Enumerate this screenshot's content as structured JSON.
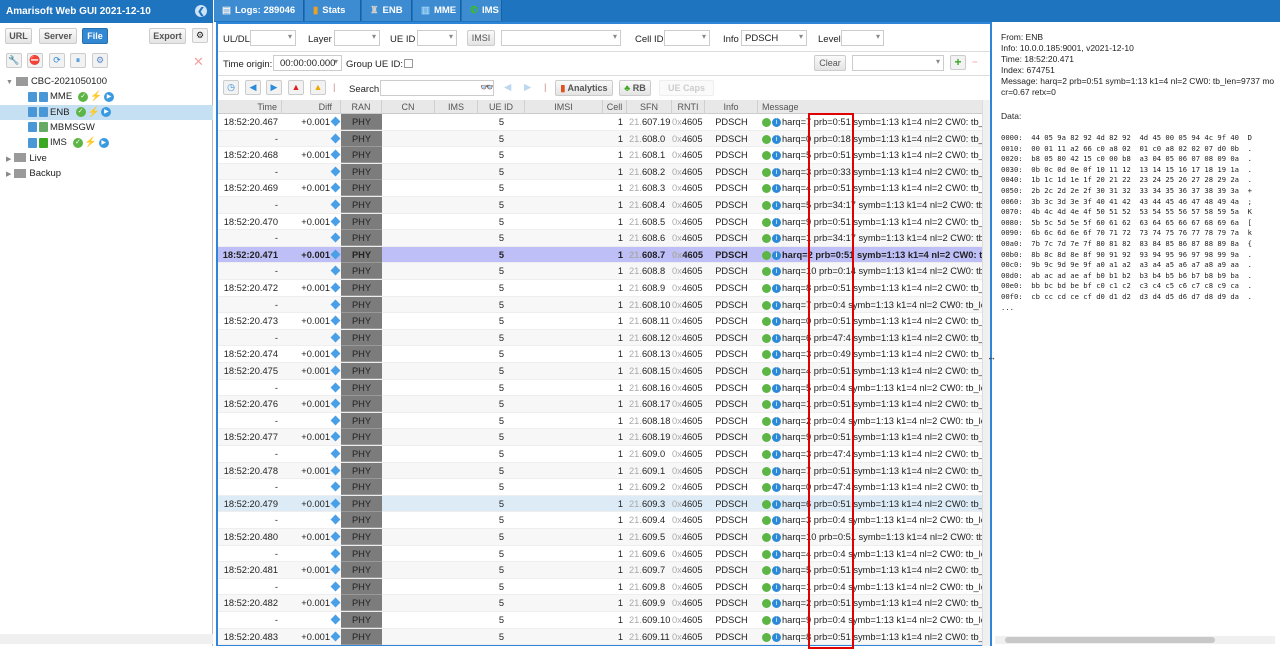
{
  "app": {
    "title": "Amarisoft Web GUI 2021-12-10"
  },
  "left": {
    "buttons": {
      "url": "URL",
      "server": "Server",
      "file": "File",
      "export": "Export"
    },
    "tree": [
      {
        "label": "CBC-2021050100",
        "type": "folder"
      },
      {
        "label": "MME",
        "status": true
      },
      {
        "label": "ENB",
        "status": true,
        "selected": true
      },
      {
        "label": "MBMSGW",
        "status": false
      },
      {
        "label": "IMS",
        "status": true
      },
      {
        "label": "Live",
        "type": "folder"
      },
      {
        "label": "Backup",
        "type": "folder"
      }
    ]
  },
  "tabs": [
    {
      "label": "Logs: 289046",
      "icon": "document-icon"
    },
    {
      "label": "Stats",
      "icon": "bar-chart-icon"
    },
    {
      "label": "ENB",
      "icon": "antenna-icon"
    },
    {
      "label": "MME",
      "icon": "server-icon"
    },
    {
      "label": "IMS",
      "icon": "phone-icon"
    }
  ],
  "filters": {
    "uldl": "UL/DL",
    "layer": "Layer",
    "ueid": "UE ID",
    "imsi": "IMSI",
    "cellid": "Cell ID",
    "info": "Info",
    "info_value": "PDSCH",
    "level": "Level",
    "time_origin": "Time origin:",
    "time_origin_value": "00:00:00.000",
    "group_ue": "Group UE ID:",
    "clear": "Clear"
  },
  "toolbar": {
    "search": "Search",
    "analytics": "Analytics",
    "rb": "RB",
    "uecaps": "UE Caps"
  },
  "columns": [
    "Time",
    "Diff",
    "RAN",
    "CN",
    "IMS",
    "UE ID",
    "IMSI",
    "Cell",
    "SFN",
    "RNTI",
    "Info",
    "Message"
  ],
  "rows": [
    [
      "18:52:20.467",
      "+0.001",
      "607.19",
      "7",
      "0:51"
    ],
    [
      "-",
      "",
      "608.0",
      "0",
      "0:18"
    ],
    [
      "18:52:20.468",
      "+0.001",
      "608.1",
      "5",
      "0:51"
    ],
    [
      "-",
      "",
      "608.2",
      "3",
      "0:33"
    ],
    [
      "18:52:20.469",
      "+0.001",
      "608.3",
      "4",
      "0:51"
    ],
    [
      "-",
      "",
      "608.4",
      "5",
      "34:17"
    ],
    [
      "18:52:20.470",
      "+0.001",
      "608.5",
      "9",
      "0:51"
    ],
    [
      "-",
      "",
      "608.6",
      "1",
      "34:17"
    ],
    [
      "18:52:20.471",
      "+0.001",
      "608.7",
      "2",
      "0:51"
    ],
    [
      "-",
      "",
      "608.8",
      "10",
      "0:14"
    ],
    [
      "18:52:20.472",
      "+0.001",
      "608.9",
      "8",
      "0:51"
    ],
    [
      "-",
      "",
      "608.10",
      "7",
      "0:4"
    ],
    [
      "18:52:20.473",
      "+0.001",
      "608.11",
      "0",
      "0:51"
    ],
    [
      "-",
      "",
      "608.12",
      "6",
      "47:4"
    ],
    [
      "18:52:20.474",
      "+0.001",
      "608.13",
      "3",
      "0:49"
    ],
    [
      "18:52:20.475",
      "+0.001",
      "608.15",
      "4",
      "0:51"
    ],
    [
      "-",
      "",
      "608.16",
      "5",
      "0:4"
    ],
    [
      "18:52:20.476",
      "+0.001",
      "608.17",
      "1",
      "0:51"
    ],
    [
      "-",
      "",
      "608.18",
      "2",
      "0:4"
    ],
    [
      "18:52:20.477",
      "+0.001",
      "608.19",
      "9",
      "0:51"
    ],
    [
      "-",
      "",
      "609.0",
      "3",
      "47:4"
    ],
    [
      "18:52:20.478",
      "+0.001",
      "609.1",
      "7",
      "0:51"
    ],
    [
      "-",
      "",
      "609.2",
      "0",
      "47:4"
    ],
    [
      "18:52:20.479",
      "+0.001",
      "609.3",
      "6",
      "0:51"
    ],
    [
      "-",
      "",
      "609.4",
      "3",
      "0:4"
    ],
    [
      "18:52:20.480",
      "+0.001",
      "609.5",
      "10",
      "0:51"
    ],
    [
      "-",
      "",
      "609.6",
      "4",
      "0:4"
    ],
    [
      "18:52:20.481",
      "+0.001",
      "609.7",
      "5",
      "0:51"
    ],
    [
      "-",
      "",
      "609.8",
      "1",
      "0:4"
    ],
    [
      "18:52:20.482",
      "+0.001",
      "609.9",
      "2",
      "0:51"
    ],
    [
      "-",
      "",
      "609.10",
      "9",
      "0:4"
    ],
    [
      "18:52:20.483",
      "+0.001",
      "609.11",
      "8",
      "0:51"
    ]
  ],
  "row_common": {
    "ran": "PHY",
    "ueid": "5",
    "cell": "1",
    "sfn_prefix": "21.",
    "rnti_prefix": "0x",
    "rnti": "4605",
    "info": "PDSCH",
    "msg_tail": " symb=1:13 k1=4 nl=2 CW0: tb_len=..."
  },
  "selected_row": 8,
  "highlighted_row": 23,
  "detail": {
    "from": "From: ENB",
    "info": "Info: 10.0.0.185:9001, v2021-12-10",
    "time": "Time: 18:52:20.471",
    "index": "Index: 674751",
    "message": "Message: harq=2 prb=0:51 symb=1:13 k1=4 nl=2 CW0: tb_len=9737 mo",
    "message2": "cr=0.67 retx=0",
    "data_label": "Data:",
    "hex": [
      "0000:  44 05 9a 82 92 4d 82 92  4d 45 00 05 94 4c 9f 40  D",
      "0010:  00 01 11 a2 66 c0 a8 02  01 c0 a8 02 02 07 d0 0b  .",
      "0020:  b8 05 80 42 15 c0 00 b8  a3 04 05 06 07 08 09 0a  .",
      "0030:  0b 0c 0d 0e 0f 10 11 12  13 14 15 16 17 18 19 1a  .",
      "0040:  1b 1c 1d 1e 1f 20 21 22  23 24 25 26 27 28 29 2a  .",
      "0050:  2b 2c 2d 2e 2f 30 31 32  33 34 35 36 37 38 39 3a  +",
      "0060:  3b 3c 3d 3e 3f 40 41 42  43 44 45 46 47 48 49 4a  ;",
      "0070:  4b 4c 4d 4e 4f 50 51 52  53 54 55 56 57 58 59 5a  K",
      "0080:  5b 5c 5d 5e 5f 60 61 62  63 64 65 66 67 68 69 6a  [",
      "0090:  6b 6c 6d 6e 6f 70 71 72  73 74 75 76 77 78 79 7a  k",
      "00a0:  7b 7c 7d 7e 7f 80 81 82  83 84 85 86 87 88 89 8a  {",
      "00b0:  8b 8c 8d 8e 8f 90 91 92  93 94 95 96 97 98 99 9a  .",
      "00c0:  9b 9c 9d 9e 9f a0 a1 a2  a3 a4 a5 a6 a7 a8 a9 aa  .",
      "00d0:  ab ac ad ae af b0 b1 b2  b3 b4 b5 b6 b7 b8 b9 ba  .",
      "00e0:  bb bc bd be bf c0 c1 c2  c3 c4 c5 c6 c7 c8 c9 ca  .",
      "00f0:  cb cc cd ce cf d0 d1 d2  d3 d4 d5 d6 d7 d8 d9 da  .",
      "..."
    ]
  },
  "colors": {
    "brand": "#1f74c0",
    "selected_row": "#bfbff8",
    "highlight_box": "#e00000",
    "ran_cell": "#7c7c7c"
  }
}
